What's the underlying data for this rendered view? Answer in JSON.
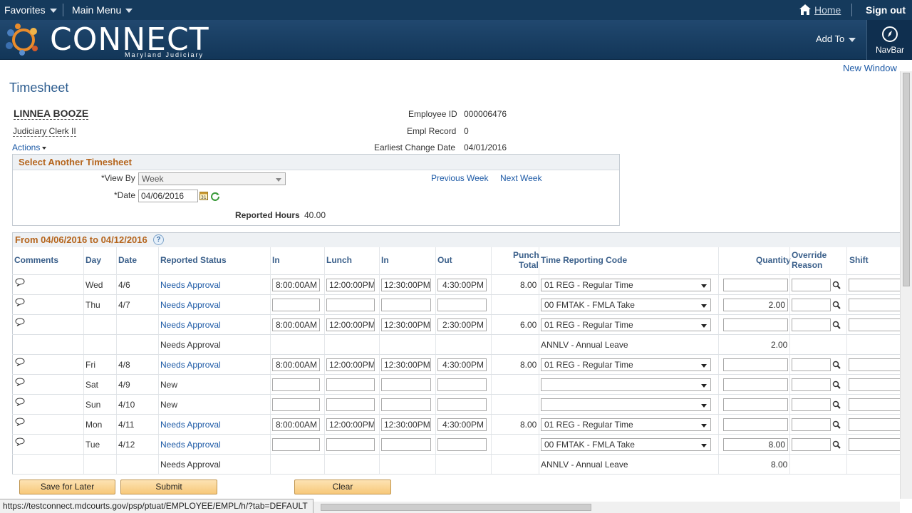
{
  "topbar": {
    "favorites": "Favorites",
    "main_menu": "Main Menu",
    "home": "Home",
    "sign_out": "Sign out"
  },
  "banner": {
    "logo_text": "CONNECT",
    "logo_sub": "Maryland Judiciary",
    "add_to": "Add To",
    "navbar": "NavBar"
  },
  "page": {
    "new_window": "New Window",
    "title": "Timesheet"
  },
  "employee": {
    "name": "LINNEA BOOZE",
    "job_title": "Judiciary Clerk II",
    "actions": "Actions",
    "id_label": "Employee ID",
    "id_value": "000006476",
    "record_label": "Empl Record",
    "record_value": "0",
    "change_label": "Earliest Change Date",
    "change_value": "04/01/2016"
  },
  "select_panel": {
    "title": "Select Another Timesheet",
    "view_by_label": "*View By",
    "view_by_value": "Week",
    "date_label": "*Date",
    "date_value": "04/06/2016",
    "previous_week": "Previous Week",
    "next_week": "Next Week",
    "reported_label": "Reported Hours",
    "reported_value": "40.00"
  },
  "grid": {
    "title": "From 04/06/2016 to 04/12/2016",
    "help_icon": "?",
    "headers": {
      "comments": "Comments",
      "day": "Day",
      "date": "Date",
      "status": "Reported Status",
      "in1": "In",
      "lunch": "Lunch",
      "in2": "In",
      "out": "Out",
      "punch1": "Punch",
      "punch2": "Total",
      "trc": "Time Reporting Code",
      "quantity": "Quantity",
      "override1": "Override",
      "override2": "Reason",
      "shift": "Shift"
    },
    "rows": [
      {
        "comment": true,
        "day": "Wed",
        "date": "4/6",
        "status": "Needs Approval",
        "status_link": true,
        "in1": "8:00:00AM",
        "lunch": "12:00:00PM",
        "in2": "12:30:00PM",
        "out": "4:30:00PM",
        "total": "8.00",
        "trc": "01 REG - Regular Time",
        "trc_editable": true,
        "quantity": "",
        "qty_editable": true
      },
      {
        "comment": true,
        "day": "Thu",
        "date": "4/7",
        "status": "Needs Approval",
        "status_link": true,
        "in1": "",
        "lunch": "",
        "in2": "",
        "out": "",
        "total": "",
        "trc": "00 FMTAK - FMLA Take",
        "trc_editable": true,
        "quantity": "2.00",
        "qty_editable": true
      },
      {
        "comment": true,
        "day": "",
        "date": "",
        "status": "Needs Approval",
        "status_link": true,
        "in1": "8:00:00AM",
        "lunch": "12:00:00PM",
        "in2": "12:30:00PM",
        "out": "2:30:00PM",
        "total": "6.00",
        "trc": "01 REG - Regular Time",
        "trc_editable": true,
        "quantity": "",
        "qty_editable": true
      },
      {
        "comment": false,
        "day": "",
        "date": "",
        "status": "Needs Approval",
        "status_link": false,
        "readonly": true,
        "trc": "ANNLV - Annual Leave",
        "trc_editable": false,
        "quantity": "2.00",
        "qty_editable": false
      },
      {
        "comment": true,
        "day": "Fri",
        "date": "4/8",
        "status": "Needs Approval",
        "status_link": true,
        "in1": "8:00:00AM",
        "lunch": "12:00:00PM",
        "in2": "12:30:00PM",
        "out": "4:30:00PM",
        "total": "8.00",
        "trc": "01 REG - Regular Time",
        "trc_editable": true,
        "quantity": "",
        "qty_editable": true
      },
      {
        "comment": true,
        "day": "Sat",
        "date": "4/9",
        "status": "New",
        "status_link": false,
        "in1": "",
        "lunch": "",
        "in2": "",
        "out": "",
        "total": "",
        "trc": "",
        "trc_editable": true,
        "quantity": "",
        "qty_editable": true
      },
      {
        "comment": true,
        "day": "Sun",
        "date": "4/10",
        "status": "New",
        "status_link": false,
        "in1": "",
        "lunch": "",
        "in2": "",
        "out": "",
        "total": "",
        "trc": "",
        "trc_editable": true,
        "quantity": "",
        "qty_editable": true
      },
      {
        "comment": true,
        "day": "Mon",
        "date": "4/11",
        "status": "Needs Approval",
        "status_link": true,
        "in1": "8:00:00AM",
        "lunch": "12:00:00PM",
        "in2": "12:30:00PM",
        "out": "4:30:00PM",
        "total": "8.00",
        "trc": "01 REG - Regular Time",
        "trc_editable": true,
        "quantity": "",
        "qty_editable": true
      },
      {
        "comment": true,
        "day": "Tue",
        "date": "4/12",
        "status": "Needs Approval",
        "status_link": true,
        "in1": "",
        "lunch": "",
        "in2": "",
        "out": "",
        "total": "",
        "trc": "00 FMTAK - FMLA Take",
        "trc_editable": true,
        "quantity": "8.00",
        "qty_editable": true
      },
      {
        "comment": false,
        "day": "",
        "date": "",
        "status": "Needs Approval",
        "status_link": false,
        "readonly": true,
        "trc": "ANNLV - Annual Leave",
        "trc_editable": false,
        "quantity": "8.00",
        "qty_editable": false
      }
    ]
  },
  "buttons": {
    "save": "Save for Later",
    "submit": "Submit",
    "clear": "Clear"
  },
  "statusbar": {
    "url": "https://testconnect.mdcourts.gov/psp/ptuat/EMPLOYEE/EMPL/h/?tab=DEFAULT"
  },
  "colors": {
    "topbar": "#153a5c",
    "link": "#1d5aa6",
    "panel_title": "#b5651d",
    "button": "#f7c879"
  }
}
